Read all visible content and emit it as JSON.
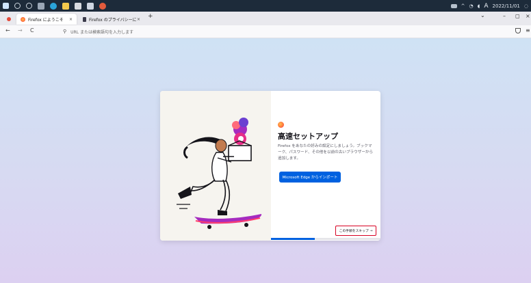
{
  "taskbar": {
    "ime_label": "A",
    "date": "2022/11/01"
  },
  "tabs": [
    {
      "label": "Firefox にようこそ",
      "active": true,
      "close": "×"
    },
    {
      "label": "Firefox のプライバシーに関する通知",
      "active": false,
      "close": "×"
    }
  ],
  "new_tab_label": "+",
  "window_controls": {
    "list": "⌄",
    "minimize": "–",
    "maximize": "◻",
    "close": "×"
  },
  "nav": {
    "back": "←",
    "forward": "→",
    "reload": "C",
    "url_placeholder": "URL または検索語句を入力します"
  },
  "onboarding": {
    "heading": "高速セットアップ",
    "description": "Firefox をあなたの好みの設定にしましょう。ブックマーク、パスワード、その他を以前の古いブラウザーから追加します。",
    "import_button": "Microsoft Edge からインポート",
    "skip_button": "この手順をスキップ →",
    "progress": 0.4
  },
  "colors": {
    "accent": "#0061e0",
    "skip_highlight": "#d70022"
  }
}
